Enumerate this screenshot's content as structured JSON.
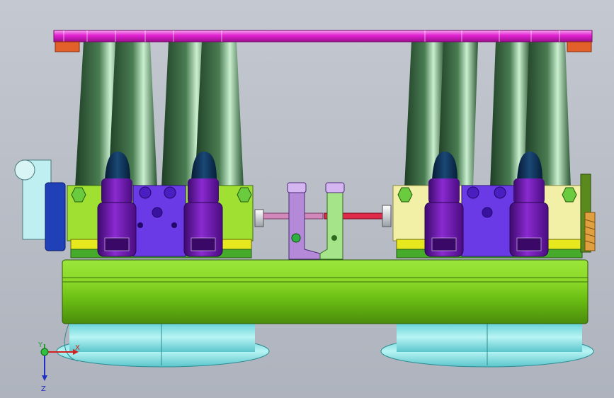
{
  "viewport": {
    "view": "front",
    "background_top": "#c4c8d0",
    "background_bottom": "#aeb3bd"
  },
  "triad": {
    "x_label": "X",
    "y_label": "Y",
    "z_label": "Z"
  },
  "parts": {
    "top_plate": "#e020d0",
    "top_plate_ends": "#e2602a",
    "trumpet": "#2e5a34",
    "injector_cap": "#0b2c4e",
    "injector_body": "#6a14a8",
    "throttle_body_left": "#9fe032",
    "throttle_body_right": "#f2f0a6",
    "center_block": "#6a3ae6",
    "fuel_rail": "#7ccc18",
    "linkage_bracket_left": "#b48ad8",
    "linkage_bracket_right": "#a6e48a",
    "linkage_rod_left": "#d089b8",
    "linkage_rod_right": "#e02a4a",
    "tps_sensor": "#2040b8",
    "air_horns": "#8ee8ea",
    "nut": "#6acb3e",
    "spring": "#e0a040"
  }
}
